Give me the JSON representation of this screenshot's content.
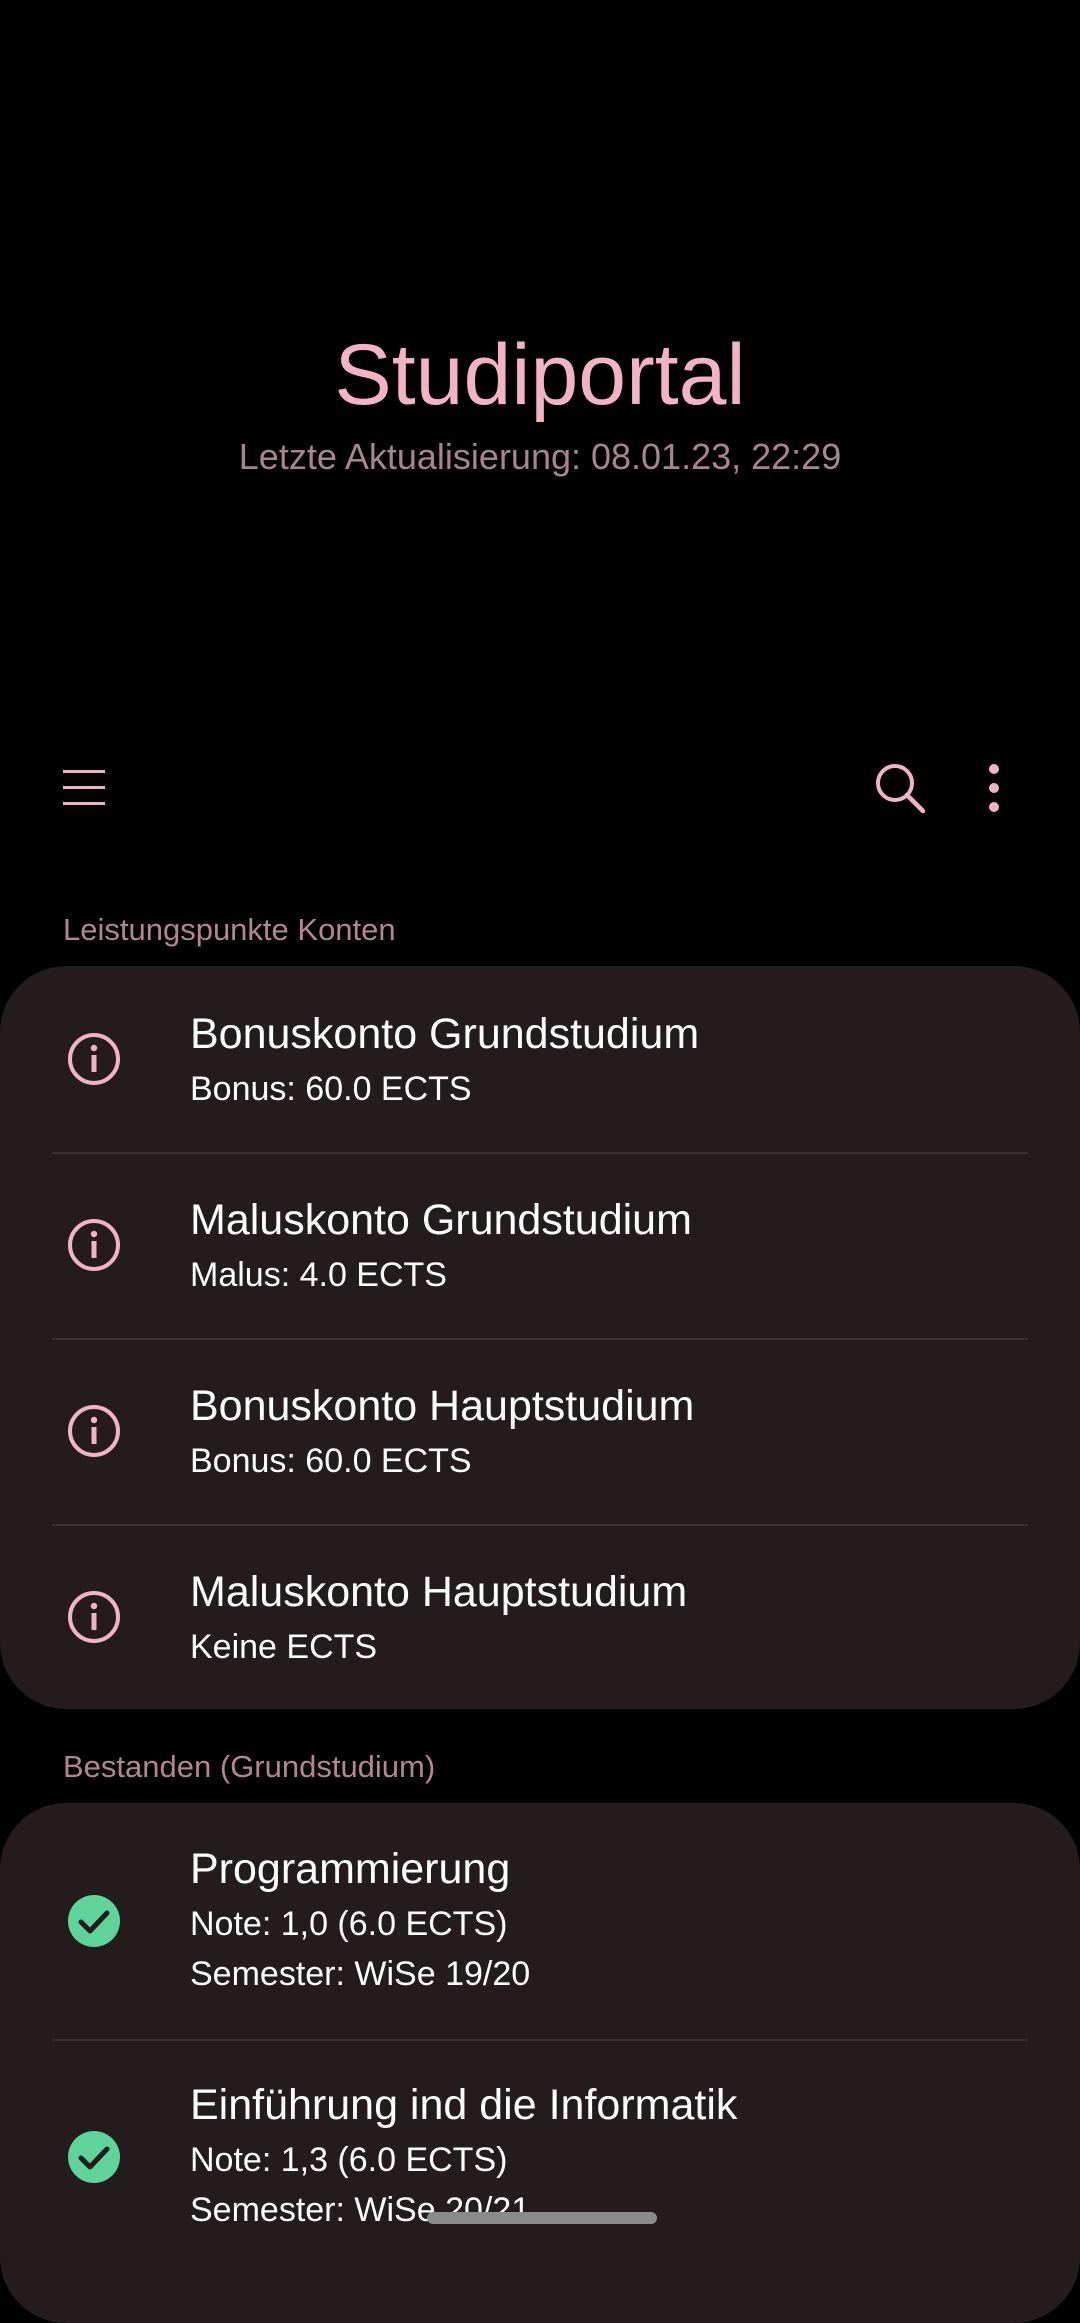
{
  "header": {
    "title": "Studiportal",
    "last_update": "Letzte Aktualisierung: 08.01.23, 22:29"
  },
  "toolbar": {
    "menu_icon": "menu-icon",
    "search_icon": "search-icon",
    "more_icon": "more-vertical-icon"
  },
  "colors": {
    "accent": "#f2b3c3",
    "section_text": "#b18690",
    "card_bg": "#241b1d",
    "success": "#5ed49b"
  },
  "sections": [
    {
      "header": "Leistungspunkte Konten",
      "items": [
        {
          "icon": "info-icon",
          "title": "Bonuskonto Grundstudium",
          "sub": "Bonus: 60.0 ECTS"
        },
        {
          "icon": "info-icon",
          "title": "Maluskonto Grundstudium",
          "sub": "Malus: 4.0 ECTS"
        },
        {
          "icon": "info-icon",
          "title": "Bonuskonto Hauptstudium",
          "sub": "Bonus: 60.0 ECTS"
        },
        {
          "icon": "info-icon",
          "title": "Maluskonto Hauptstudium",
          "sub": "Keine ECTS"
        }
      ]
    },
    {
      "header": "Bestanden (Grundstudium)",
      "items": [
        {
          "icon": "check-circle-icon",
          "title": "Programmierung",
          "sub": "Note: 1,0 (6.0 ECTS)",
          "sub2": "Semester: WiSe 19/20"
        },
        {
          "icon": "check-circle-icon",
          "title": "Einführung ind die Informatik",
          "sub": "Note: 1,3 (6.0 ECTS)",
          "sub2": "Semester: WiSe 20/21"
        }
      ]
    }
  ]
}
